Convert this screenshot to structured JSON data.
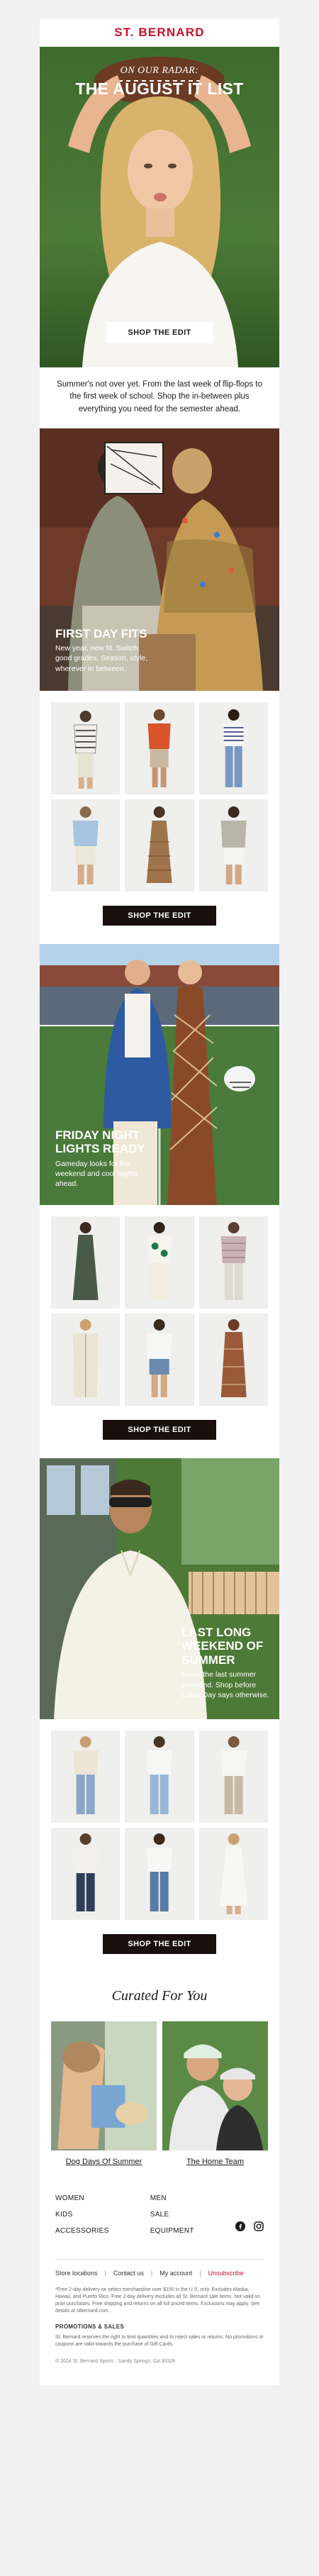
{
  "brand": {
    "logo": "ST. BERNARD"
  },
  "hero": {
    "kicker": "ON OUR RADAR:",
    "title": "THE AUGUST IT LIST",
    "button": "SHOP THE EDIT"
  },
  "intro": {
    "text": "Summer's not over yet. From the last week of flip-flops to the first week of school. Shop the in-between plus everything you need for the semester ahead."
  },
  "feature1": {
    "title": "FIRST DAY FITS",
    "subtitle": "New year, new fit. Switch good grades. Season, style, wherever in between."
  },
  "grid1": {
    "button": "SHOP THE EDIT"
  },
  "feature2": {
    "title": "FRIDAY NIGHT LIGHTS READY",
    "subtitle": "Gameday looks for the weekend and cool nights ahead."
  },
  "grid2": {
    "button": "SHOP THE EDIT"
  },
  "feature3": {
    "title": "LAST LONG WEEKEND OF SUMMER",
    "subtitle": "Savor the last summer weekend. Shop before Labor Day says otherwise."
  },
  "grid3": {
    "button": "SHOP THE EDIT"
  },
  "curated": {
    "title": "Curated For You",
    "cards": [
      {
        "label": "Dog Days Of Summer"
      },
      {
        "label": "The Home Team"
      }
    ]
  },
  "footer": {
    "nav_left": [
      "WOMEN",
      "KIDS",
      "ACCESSORIES"
    ],
    "nav_right": [
      "MEN",
      "SALE",
      "EQUIPMENT"
    ],
    "links": [
      "Store locations",
      "Contact us",
      "My account",
      "Unsubscribe"
    ],
    "legal": "*Free 2-day delivery on select merchandise over $150 in the U.S. only. Excludes Alaska, Hawaii, and Puerto Rico. Free 2-day delivery excludes all St. Bernard sale items. Not valid on prior purchases. Free shipping and returns on all full priced items. Exclusions may apply. See details at stbernard.com.",
    "promo_heading": "PROMOTIONS & SALES",
    "promo_text": "St. Bernard reserves the right to limit quantities and to reject sales or returns. No promotions or coupons are valid towards the purchase of Gift Cards.",
    "address": "© 2024 St. Bernard Sports  ·  Sandy Springs, GA 30328"
  },
  "colors": {
    "brand_red": "#c8102e",
    "button_dark": "#1a0f0f"
  }
}
